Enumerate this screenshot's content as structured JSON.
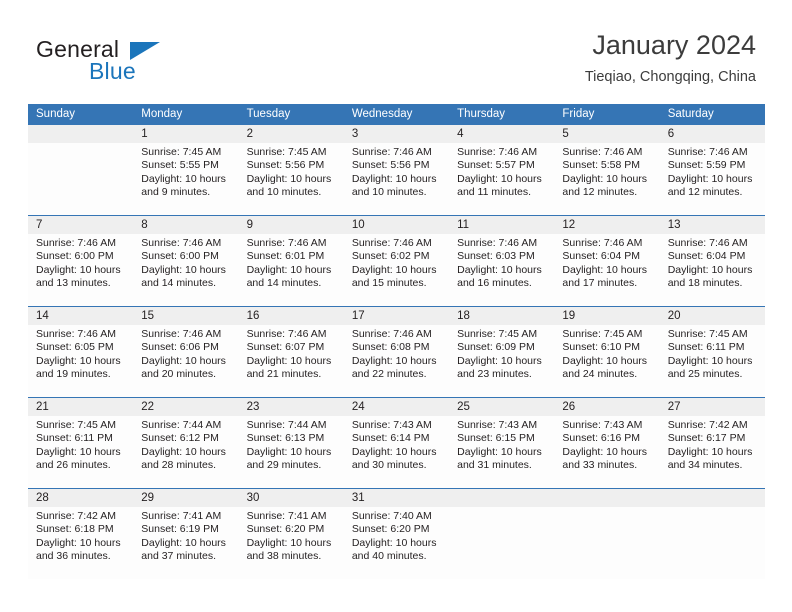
{
  "brand": {
    "name_part1": "General",
    "name_part2": "Blue"
  },
  "header": {
    "title": "January 2024",
    "subtitle": "Tieqiao, Chongqing, China"
  },
  "colors": {
    "header_blue": "#3575b5",
    "brand_blue": "#1b75bb",
    "daynum_band": "#efefef",
    "cell_bg": "#fdfdfd",
    "text": "#231f20"
  },
  "weekdays": [
    "Sunday",
    "Monday",
    "Tuesday",
    "Wednesday",
    "Thursday",
    "Friday",
    "Saturday"
  ],
  "weeks": [
    [
      {
        "day": "",
        "lines": []
      },
      {
        "day": "1",
        "lines": [
          "Sunrise: 7:45 AM",
          "Sunset: 5:55 PM",
          "Daylight: 10 hours",
          "and 9 minutes."
        ]
      },
      {
        "day": "2",
        "lines": [
          "Sunrise: 7:45 AM",
          "Sunset: 5:56 PM",
          "Daylight: 10 hours",
          "and 10 minutes."
        ]
      },
      {
        "day": "3",
        "lines": [
          "Sunrise: 7:46 AM",
          "Sunset: 5:56 PM",
          "Daylight: 10 hours",
          "and 10 minutes."
        ]
      },
      {
        "day": "4",
        "lines": [
          "Sunrise: 7:46 AM",
          "Sunset: 5:57 PM",
          "Daylight: 10 hours",
          "and 11 minutes."
        ]
      },
      {
        "day": "5",
        "lines": [
          "Sunrise: 7:46 AM",
          "Sunset: 5:58 PM",
          "Daylight: 10 hours",
          "and 12 minutes."
        ]
      },
      {
        "day": "6",
        "lines": [
          "Sunrise: 7:46 AM",
          "Sunset: 5:59 PM",
          "Daylight: 10 hours",
          "and 12 minutes."
        ]
      }
    ],
    [
      {
        "day": "7",
        "lines": [
          "Sunrise: 7:46 AM",
          "Sunset: 6:00 PM",
          "Daylight: 10 hours",
          "and 13 minutes."
        ]
      },
      {
        "day": "8",
        "lines": [
          "Sunrise: 7:46 AM",
          "Sunset: 6:00 PM",
          "Daylight: 10 hours",
          "and 14 minutes."
        ]
      },
      {
        "day": "9",
        "lines": [
          "Sunrise: 7:46 AM",
          "Sunset: 6:01 PM",
          "Daylight: 10 hours",
          "and 14 minutes."
        ]
      },
      {
        "day": "10",
        "lines": [
          "Sunrise: 7:46 AM",
          "Sunset: 6:02 PM",
          "Daylight: 10 hours",
          "and 15 minutes."
        ]
      },
      {
        "day": "11",
        "lines": [
          "Sunrise: 7:46 AM",
          "Sunset: 6:03 PM",
          "Daylight: 10 hours",
          "and 16 minutes."
        ]
      },
      {
        "day": "12",
        "lines": [
          "Sunrise: 7:46 AM",
          "Sunset: 6:04 PM",
          "Daylight: 10 hours",
          "and 17 minutes."
        ]
      },
      {
        "day": "13",
        "lines": [
          "Sunrise: 7:46 AM",
          "Sunset: 6:04 PM",
          "Daylight: 10 hours",
          "and 18 minutes."
        ]
      }
    ],
    [
      {
        "day": "14",
        "lines": [
          "Sunrise: 7:46 AM",
          "Sunset: 6:05 PM",
          "Daylight: 10 hours",
          "and 19 minutes."
        ]
      },
      {
        "day": "15",
        "lines": [
          "Sunrise: 7:46 AM",
          "Sunset: 6:06 PM",
          "Daylight: 10 hours",
          "and 20 minutes."
        ]
      },
      {
        "day": "16",
        "lines": [
          "Sunrise: 7:46 AM",
          "Sunset: 6:07 PM",
          "Daylight: 10 hours",
          "and 21 minutes."
        ]
      },
      {
        "day": "17",
        "lines": [
          "Sunrise: 7:46 AM",
          "Sunset: 6:08 PM",
          "Daylight: 10 hours",
          "and 22 minutes."
        ]
      },
      {
        "day": "18",
        "lines": [
          "Sunrise: 7:45 AM",
          "Sunset: 6:09 PM",
          "Daylight: 10 hours",
          "and 23 minutes."
        ]
      },
      {
        "day": "19",
        "lines": [
          "Sunrise: 7:45 AM",
          "Sunset: 6:10 PM",
          "Daylight: 10 hours",
          "and 24 minutes."
        ]
      },
      {
        "day": "20",
        "lines": [
          "Sunrise: 7:45 AM",
          "Sunset: 6:11 PM",
          "Daylight: 10 hours",
          "and 25 minutes."
        ]
      }
    ],
    [
      {
        "day": "21",
        "lines": [
          "Sunrise: 7:45 AM",
          "Sunset: 6:11 PM",
          "Daylight: 10 hours",
          "and 26 minutes."
        ]
      },
      {
        "day": "22",
        "lines": [
          "Sunrise: 7:44 AM",
          "Sunset: 6:12 PM",
          "Daylight: 10 hours",
          "and 28 minutes."
        ]
      },
      {
        "day": "23",
        "lines": [
          "Sunrise: 7:44 AM",
          "Sunset: 6:13 PM",
          "Daylight: 10 hours",
          "and 29 minutes."
        ]
      },
      {
        "day": "24",
        "lines": [
          "Sunrise: 7:43 AM",
          "Sunset: 6:14 PM",
          "Daylight: 10 hours",
          "and 30 minutes."
        ]
      },
      {
        "day": "25",
        "lines": [
          "Sunrise: 7:43 AM",
          "Sunset: 6:15 PM",
          "Daylight: 10 hours",
          "and 31 minutes."
        ]
      },
      {
        "day": "26",
        "lines": [
          "Sunrise: 7:43 AM",
          "Sunset: 6:16 PM",
          "Daylight: 10 hours",
          "and 33 minutes."
        ]
      },
      {
        "day": "27",
        "lines": [
          "Sunrise: 7:42 AM",
          "Sunset: 6:17 PM",
          "Daylight: 10 hours",
          "and 34 minutes."
        ]
      }
    ],
    [
      {
        "day": "28",
        "lines": [
          "Sunrise: 7:42 AM",
          "Sunset: 6:18 PM",
          "Daylight: 10 hours",
          "and 36 minutes."
        ]
      },
      {
        "day": "29",
        "lines": [
          "Sunrise: 7:41 AM",
          "Sunset: 6:19 PM",
          "Daylight: 10 hours",
          "and 37 minutes."
        ]
      },
      {
        "day": "30",
        "lines": [
          "Sunrise: 7:41 AM",
          "Sunset: 6:20 PM",
          "Daylight: 10 hours",
          "and 38 minutes."
        ]
      },
      {
        "day": "31",
        "lines": [
          "Sunrise: 7:40 AM",
          "Sunset: 6:20 PM",
          "Daylight: 10 hours",
          "and 40 minutes."
        ]
      },
      {
        "day": "",
        "lines": []
      },
      {
        "day": "",
        "lines": []
      },
      {
        "day": "",
        "lines": []
      }
    ]
  ]
}
